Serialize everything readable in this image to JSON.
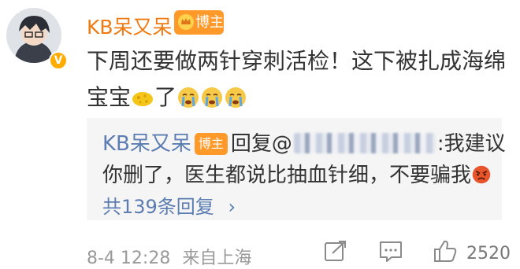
{
  "post": {
    "username": "KB呆又呆",
    "badge_label": "博主",
    "text_line1": "下周还要做两针穿刺活检！这下被扎成海绵",
    "text_line2": "宝宝",
    "text_tail": "了"
  },
  "quote": {
    "username": "KB呆又呆",
    "badge_label": "博主",
    "reply_prefix": "回复@",
    "reply_text": ":我建议",
    "line2": "你删了，医生都说比抽血针细，不要骗我",
    "replies_label": "共139条回复",
    "chevron": "›"
  },
  "footer": {
    "time": "8-4 12:28",
    "source": "来自上海",
    "like_count": "2520"
  },
  "colors": {
    "username_orange": "#f07a12",
    "link_blue": "#5b7db2",
    "badge": "#ff9a2a"
  }
}
